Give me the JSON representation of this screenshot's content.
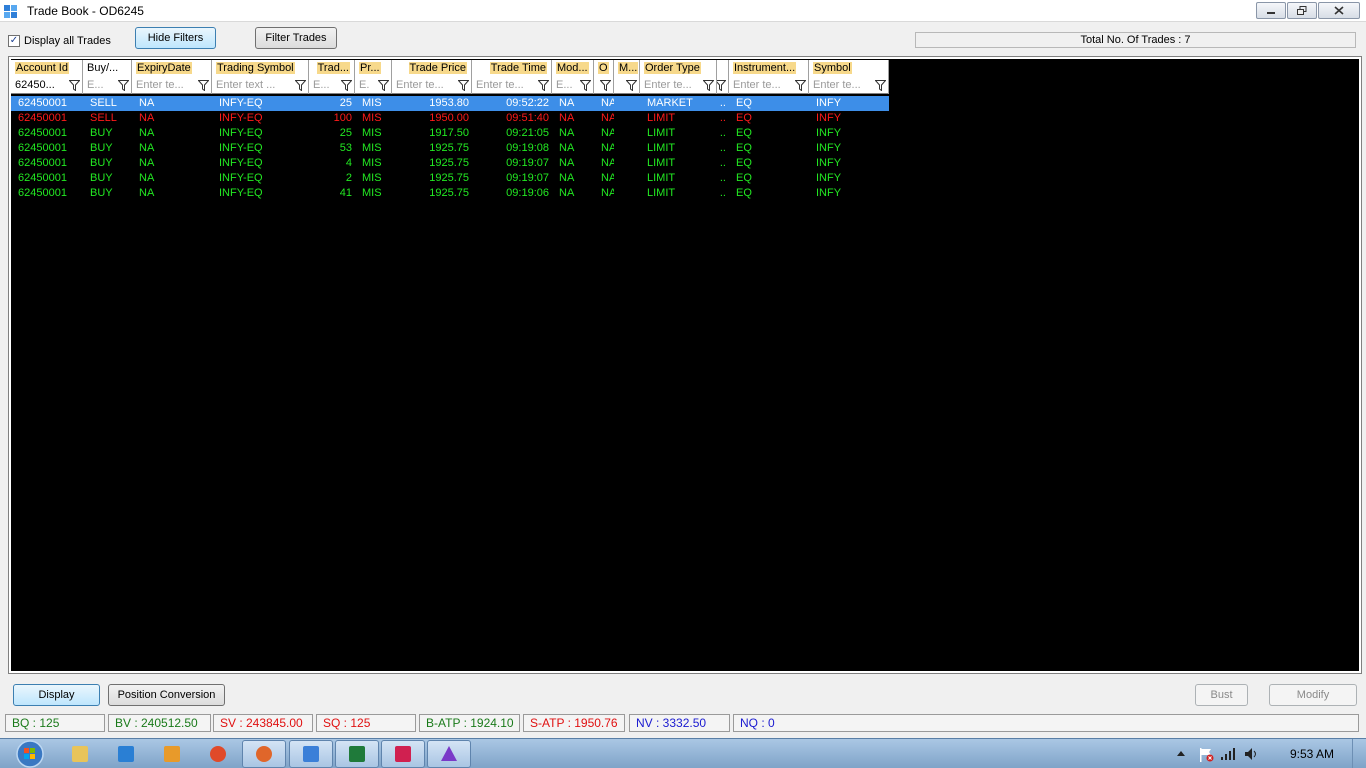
{
  "window": {
    "title": "Trade Book - OD6245"
  },
  "toolbar": {
    "display_all_label": "Display all Trades",
    "display_all_checked": "✓",
    "hide_filters_label": "Hide Filters",
    "filter_trades_label": "Filter Trades",
    "total_trades": "Total No. Of Trades : 7"
  },
  "grid": {
    "columns": [
      "Account Id",
      "Buy/...",
      "ExpiryDate",
      "Trading Symbol",
      "Trad...",
      "Pr...",
      "Trade Price",
      "Trade Time",
      "Mod...",
      "O",
      "M...",
      "Order Type",
      "",
      "Instrument...",
      "Symbol"
    ],
    "filters": [
      "62450...",
      "E...",
      "Enter te...",
      "Enter text ...",
      "E...",
      "E.",
      "Enter te...",
      "Enter te...",
      "E...",
      "",
      "",
      "Enter te...",
      "",
      "Enter te...",
      "Enter te..."
    ],
    "rows": [
      {
        "cells": [
          "62450001",
          "SELL",
          "NA",
          "INFY-EQ",
          "25",
          "MIS",
          "1953.80",
          "09:52:22",
          "NA",
          "NA",
          "",
          "MARKET",
          "..",
          "EQ",
          "INFY"
        ],
        "color": "#ffffff",
        "selected": true
      },
      {
        "cells": [
          "62450001",
          "SELL",
          "NA",
          "INFY-EQ",
          "100",
          "MIS",
          "1950.00",
          "09:51:40",
          "NA",
          "NA",
          "",
          "LIMIT",
          "..",
          "EQ",
          "INFY"
        ],
        "color": "#ff1a1a",
        "selected": false
      },
      {
        "cells": [
          "62450001",
          "BUY",
          "NA",
          "INFY-EQ",
          "25",
          "MIS",
          "1917.50",
          "09:21:05",
          "NA",
          "NA",
          "",
          "LIMIT",
          "..",
          "EQ",
          "INFY"
        ],
        "color": "#22e822",
        "selected": false
      },
      {
        "cells": [
          "62450001",
          "BUY",
          "NA",
          "INFY-EQ",
          "53",
          "MIS",
          "1925.75",
          "09:19:08",
          "NA",
          "NA",
          "",
          "LIMIT",
          "..",
          "EQ",
          "INFY"
        ],
        "color": "#22e822",
        "selected": false
      },
      {
        "cells": [
          "62450001",
          "BUY",
          "NA",
          "INFY-EQ",
          "4",
          "MIS",
          "1925.75",
          "09:19:07",
          "NA",
          "NA",
          "",
          "LIMIT",
          "..",
          "EQ",
          "INFY"
        ],
        "color": "#22e822",
        "selected": false
      },
      {
        "cells": [
          "62450001",
          "BUY",
          "NA",
          "INFY-EQ",
          "2",
          "MIS",
          "1925.75",
          "09:19:07",
          "NA",
          "NA",
          "",
          "LIMIT",
          "..",
          "EQ",
          "INFY"
        ],
        "color": "#22e822",
        "selected": false
      },
      {
        "cells": [
          "62450001",
          "BUY",
          "NA",
          "INFY-EQ",
          "41",
          "MIS",
          "1925.75",
          "09:19:06",
          "NA",
          "NA",
          "",
          "LIMIT",
          "..",
          "EQ",
          "INFY"
        ],
        "color": "#22e822",
        "selected": false
      }
    ]
  },
  "actions": {
    "display_label": "Display",
    "position_conversion_label": "Position Conversion",
    "bust_label": "Bust",
    "modify_label": "Modify"
  },
  "status": [
    {
      "text": "BQ : 125",
      "color": "#1a7a1a"
    },
    {
      "text": "BV : 240512.50",
      "color": "#1a7a1a"
    },
    {
      "text": "SV : 243845.00",
      "color": "#e01010"
    },
    {
      "text": "SQ : 125",
      "color": "#e01010"
    },
    {
      "text": "B-ATP : 1924.10",
      "color": "#1a7a1a"
    },
    {
      "text": "S-ATP : 1950.76",
      "color": "#e01010"
    },
    {
      "text": "NV : 3332.50",
      "color": "#1a1ad0"
    },
    {
      "text": "NQ : 0",
      "color": "#1a1ad0"
    }
  ],
  "taskbar": {
    "apps": [
      "explorer-icon",
      "internet-explorer-icon",
      "media-player-icon",
      "chrome-icon",
      "firefox-icon",
      "trading-app-icon",
      "excel-icon",
      "app-icon",
      "triangle-app-icon"
    ],
    "clock": "9:53 AM"
  }
}
